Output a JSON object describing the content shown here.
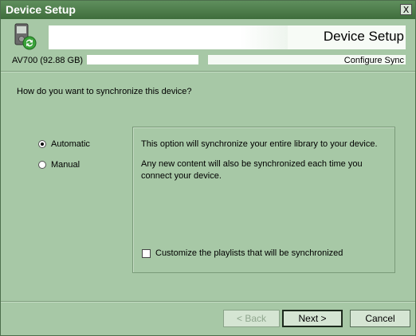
{
  "window": {
    "title": "Device Setup",
    "close_label": "X"
  },
  "header": {
    "title": "Device Setup",
    "device_name": "AV700 (92.88 GB)",
    "step_label": "Configure Sync",
    "icon": "sync-device-icon"
  },
  "main": {
    "question": "How do you want to synchronize this device?",
    "options": [
      {
        "label": "Automatic",
        "selected": true
      },
      {
        "label": "Manual",
        "selected": false
      }
    ],
    "description_line1": "This option will synchronize your entire library to your device.",
    "description_line2": "Any new content will also be synchronized each time you connect your device.",
    "customize_label": "Customize the playlists that will be synchronized",
    "customize_checked": false
  },
  "buttons": {
    "back": "< Back",
    "next": "Next >",
    "cancel": "Cancel"
  },
  "colors": {
    "background": "#a7c8a6",
    "titlebar": "#3f6d3c",
    "button": "#d5e5d3"
  }
}
